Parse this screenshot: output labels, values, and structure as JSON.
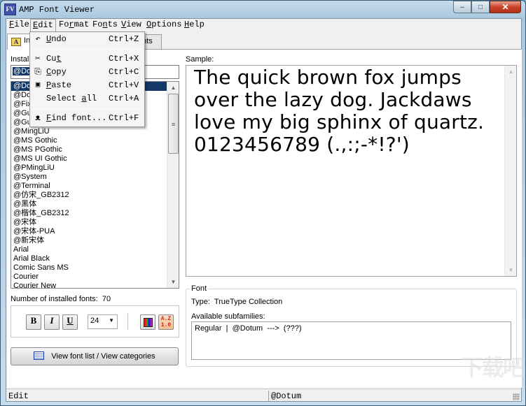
{
  "window": {
    "title": "AMP Font Viewer",
    "app_icon_text": "FV",
    "controls": {
      "minimize": "–",
      "maximize": "□",
      "close": "✕"
    }
  },
  "menubar": {
    "items": [
      {
        "label": "File",
        "mnemonic": "F",
        "rest": "ile"
      },
      {
        "label": "Edit",
        "mnemonic": "E",
        "rest": "dit"
      },
      {
        "label": "Format",
        "pre": "Fo",
        "mnemonic": "r",
        "rest": "mat"
      },
      {
        "label": "Fonts",
        "pre": "Fo",
        "mnemonic": "n",
        "rest": "ts"
      },
      {
        "label": "View",
        "mnemonic": "V",
        "rest": "iew"
      },
      {
        "label": "Options",
        "mnemonic": "O",
        "rest": "ptions"
      },
      {
        "label": "Help",
        "mnemonic": "H",
        "rest": "elp"
      }
    ],
    "open_menu": "Edit"
  },
  "edit_menu": {
    "items": [
      {
        "icon": "undo-icon",
        "glyph": "↶",
        "pre": "",
        "mnemonic": "U",
        "rest": "ndo",
        "shortcut": "Ctrl+Z"
      },
      {
        "icon": "cut-icon",
        "glyph": "✂",
        "pre": "Cu",
        "mnemonic": "t",
        "rest": "",
        "shortcut": "Ctrl+X"
      },
      {
        "icon": "copy-icon",
        "glyph": "⎘",
        "pre": "",
        "mnemonic": "C",
        "rest": "opy",
        "shortcut": "Ctrl+C"
      },
      {
        "icon": "paste-icon",
        "glyph": "📋",
        "pre": "",
        "mnemonic": "P",
        "rest": "aste",
        "shortcut": "Ctrl+V"
      },
      {
        "icon": "",
        "glyph": "",
        "pre": "Select ",
        "mnemonic": "a",
        "rest": "ll",
        "shortcut": "Ctrl+A"
      },
      {
        "icon": "binoculars-icon",
        "glyph": "🔭",
        "pre": "",
        "mnemonic": "F",
        "rest": "ind font...",
        "shortcut": "Ctrl+F"
      }
    ]
  },
  "tabs": {
    "installed_label": "Installed fonts",
    "installed_visible": "In",
    "other_label_visible": "onts"
  },
  "left_panel": {
    "installed_label": "Installed fonts:",
    "installed_label_visible": "Instal",
    "search_value": "@Dotum",
    "search_value_visible": "@Dot",
    "fonts": [
      "@Dotum",
      "@DotumChe",
      "@Fixedsys",
      "@Gulim",
      "@GulimChe",
      "@MingLiU",
      "@MS Gothic",
      "@MS PGothic",
      "@MS UI Gothic",
      "@PMingLiU",
      "@System",
      "@Terminal",
      "@仿宋_GB2312",
      "@黑体",
      "@楷体_GB2312",
      "@宋体",
      "@宋体-PUA",
      "@新宋体",
      "Arial",
      "Arial Black",
      "Comic Sans MS",
      "Courier",
      "Courier New"
    ],
    "fonts_visible_prefix": [
      "@Do",
      "@Do",
      "@Fix",
      "@Gu",
      "@Gu"
    ],
    "selected_index": 0,
    "count_label": "Number of installed fonts:",
    "count_value": "70",
    "toolbar": {
      "bold": "B",
      "italic": "I",
      "underline": "U",
      "size": "24",
      "az_top": "A.Z",
      "az_bottom": "1.0"
    },
    "view_list_button": "View font list / View categories"
  },
  "right_panel": {
    "sample_label": "Sample:",
    "sample_text": "The quick brown fox jumps over the lazy dog. Jackdaws love my big sphinx of quartz. 0123456789 (.,:;-*!?')",
    "font_group_title": "Font",
    "type_label": "Type:",
    "type_value": "TrueType Collection",
    "subfamilies_label": "Available subfamilies:",
    "subfamilies_value": "Regular  |  @Dotum  --->  (???)"
  },
  "statusbar": {
    "left": "Edit",
    "right": "@Dotum"
  },
  "watermark": "下载吧"
}
